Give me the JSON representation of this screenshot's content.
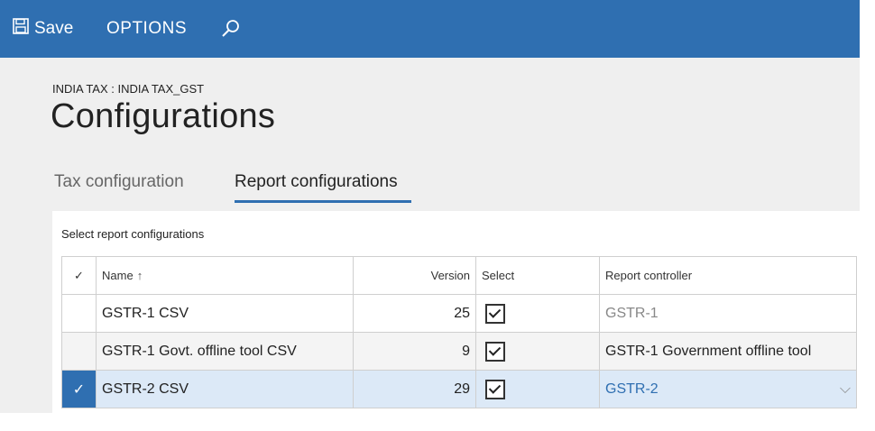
{
  "toolbar": {
    "save_label": "Save",
    "options_label": "OPTIONS"
  },
  "breadcrumb": "INDIA TAX : INDIA TAX_GST",
  "page_title": "Configurations",
  "tabs": [
    {
      "label": "Tax configuration",
      "active": false
    },
    {
      "label": "Report configurations",
      "active": true
    }
  ],
  "section_label": "Select report configurations",
  "grid": {
    "headers": {
      "check": "✓",
      "name": "Name",
      "name_sort": "↑",
      "version": "Version",
      "select": "Select",
      "controller": "Report controller"
    },
    "rows": [
      {
        "name": "GSTR-1 CSV",
        "version": "25",
        "selected": true,
        "controller": "GSTR-1"
      },
      {
        "name": "GSTR-1 Govt. offline tool CSV",
        "version": "9",
        "selected": true,
        "controller": "GSTR-1 Government offline tool"
      },
      {
        "name": "GSTR-2 CSV",
        "version": "29",
        "selected": true,
        "controller": "GSTR-2"
      }
    ]
  },
  "colors": {
    "accent": "#2f6fb1",
    "content_bg": "#efefef",
    "selected_row": "#dce9f7"
  }
}
